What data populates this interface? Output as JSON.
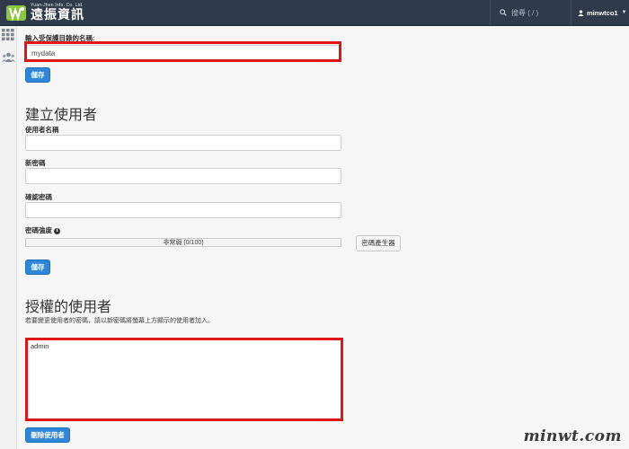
{
  "header": {
    "logo_sub": "Yuan-Jhen Info. Co. Ltd.",
    "logo_main": "遠振資訊",
    "search_placeholder": "搜尋 ( / )",
    "user_name": "minwtco1",
    "colors": {
      "topbar": "#2f3b4a",
      "accent": "#2e86d8",
      "highlight": "#e01616"
    }
  },
  "rail": {
    "icons": [
      "apps-grid-icon",
      "users-icon"
    ]
  },
  "directory": {
    "label": "輸入受保護目錄的名稱:",
    "value": "mydata",
    "save_label": "儲存"
  },
  "create_user": {
    "heading": "建立使用者",
    "username_label": "使用者名稱",
    "username_value": "",
    "password_label": "新密碼",
    "password_value": "",
    "confirm_label": "確認密碼",
    "confirm_value": "",
    "strength_label": "密碼強度",
    "strength_text": "非常弱 (0/100)",
    "strength_value": 0,
    "generator_label": "密碼產生器",
    "save_label": "儲存"
  },
  "authorized": {
    "heading": "授權的使用者",
    "help": "若要變更使用者的密碼，請以新密碼將螢幕上方顯示的使用者加入。",
    "users": [
      "admin"
    ],
    "delete_label": "刪除使用者"
  },
  "watermark": "minwt.com"
}
